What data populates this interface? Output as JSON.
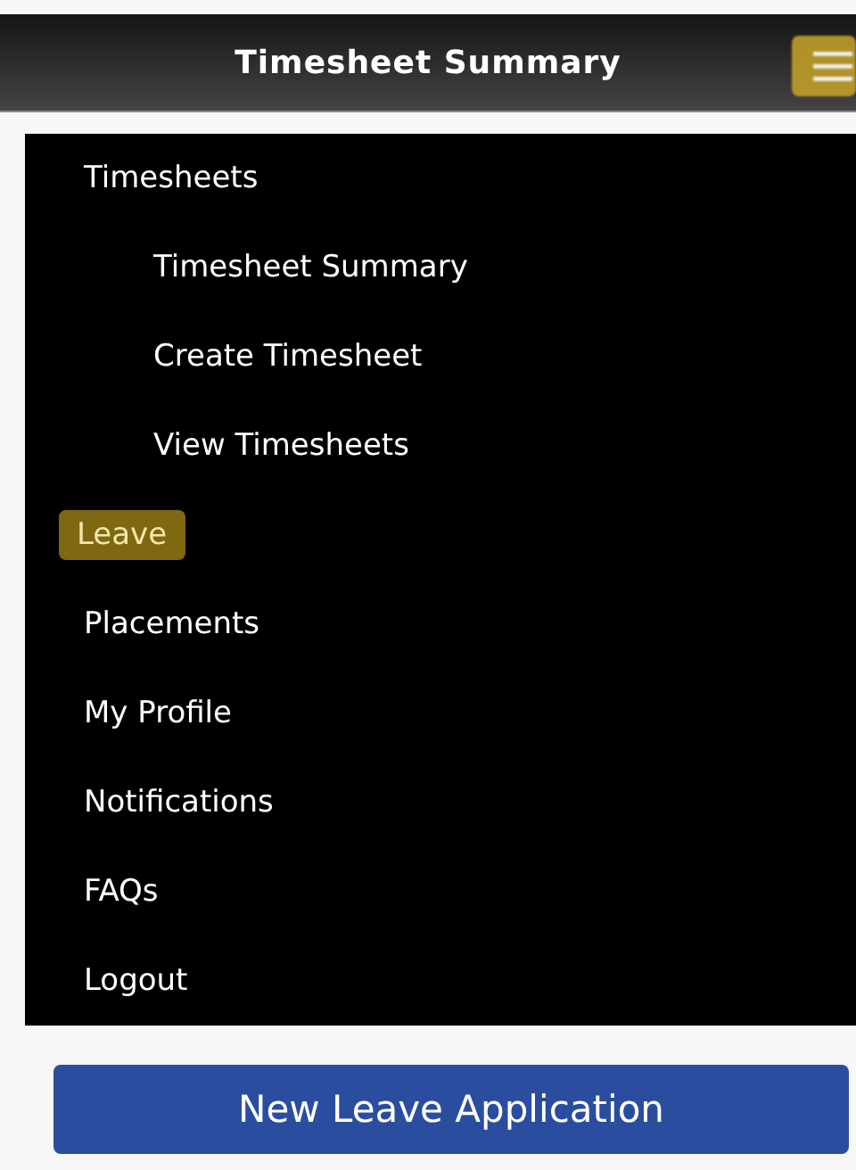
{
  "header": {
    "title": "Timesheet Summary",
    "menu_button": {
      "highlighted": true
    }
  },
  "menu": [
    {
      "label": "Timesheets",
      "highlighted": false,
      "children": [
        {
          "label": "Timesheet Summary",
          "highlighted": false
        },
        {
          "label": "Create Timesheet",
          "highlighted": false
        },
        {
          "label": "View Timesheets",
          "highlighted": false
        }
      ]
    },
    {
      "label": "Leave",
      "highlighted": true
    },
    {
      "label": "Placements",
      "highlighted": false
    },
    {
      "label": "My Profile",
      "highlighted": false
    },
    {
      "label": "Notifications",
      "highlighted": false
    },
    {
      "label": "FAQs",
      "highlighted": false
    },
    {
      "label": "Logout",
      "highlighted": false
    }
  ],
  "button": "New Leave Application"
}
